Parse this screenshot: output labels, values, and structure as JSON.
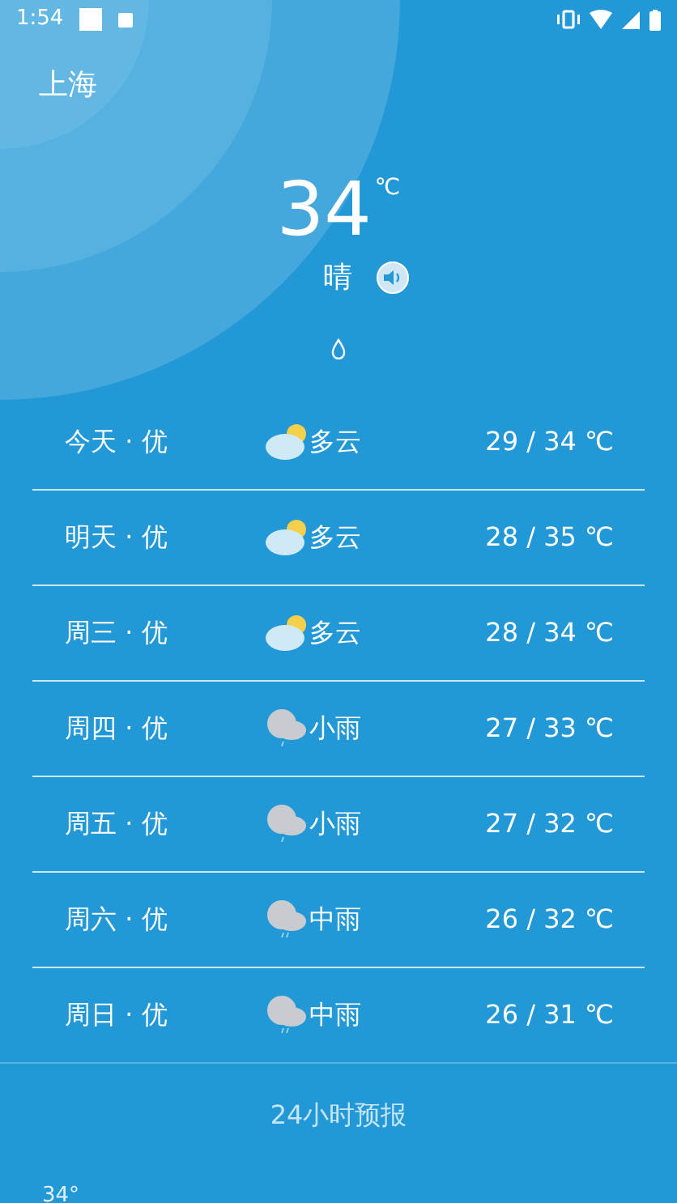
{
  "status_bar": {
    "time": "1:54"
  },
  "city": "上海",
  "current": {
    "temperature": "34",
    "unit": "℃",
    "condition": "晴"
  },
  "forecast": [
    {
      "day": "今天 · 优",
      "kind": "cloudy_sun",
      "condition": "多云",
      "temps": "29 / 34 ℃"
    },
    {
      "day": "明天 · 优",
      "kind": "cloudy_sun",
      "condition": "多云",
      "temps": "28 / 35 ℃"
    },
    {
      "day": "周三 · 优",
      "kind": "cloudy_sun",
      "condition": "多云",
      "temps": "28 / 34 ℃"
    },
    {
      "day": "周四 · 优",
      "kind": "light_rain",
      "condition": "小雨",
      "temps": "27 / 33 ℃"
    },
    {
      "day": "周五 · 优",
      "kind": "light_rain",
      "condition": "小雨",
      "temps": "27 / 32 ℃"
    },
    {
      "day": "周六 · 优",
      "kind": "moderate_rain",
      "condition": "中雨",
      "temps": "26 / 32 ℃"
    },
    {
      "day": "周日 · 优",
      "kind": "moderate_rain",
      "condition": "中雨",
      "temps": "26 / 31 ℃"
    }
  ],
  "hourly": {
    "title": "24小时预报",
    "first_temp": "34°"
  }
}
